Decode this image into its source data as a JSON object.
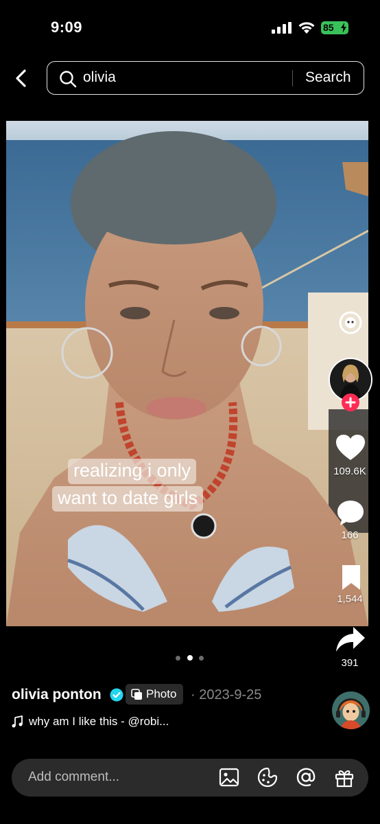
{
  "status_bar": {
    "time": "9:09",
    "battery": "85"
  },
  "search": {
    "query": "olivia",
    "button_label": "Search"
  },
  "post": {
    "caption_line1": "realizing i only",
    "caption_line2": "want to date girls",
    "likes": "109.6K",
    "comments": "166",
    "saves": "1,544",
    "shares": "391",
    "carousel_total": 3,
    "carousel_active": 2
  },
  "author": {
    "name": "olivia ponton",
    "type_label": "Photo",
    "date": "· 2023-9-25",
    "music": "why am I like this - @robi..."
  },
  "comment_bar": {
    "placeholder": "Add comment..."
  },
  "colors": {
    "background": "#000000",
    "like_accent": "#fe2c55",
    "verified": "#20d5ec",
    "battery": "#3ac25a"
  }
}
